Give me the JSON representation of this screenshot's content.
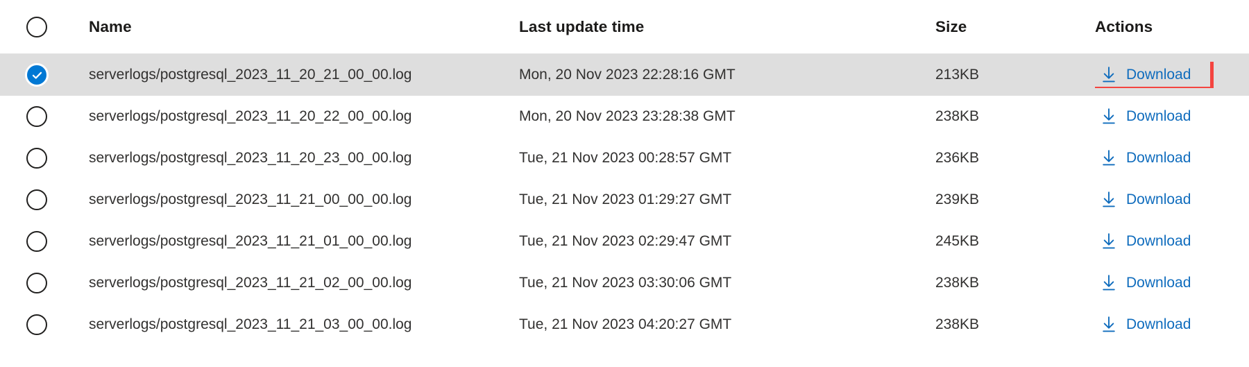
{
  "table": {
    "columns": {
      "select": "",
      "name": "Name",
      "last_update_time": "Last update time",
      "size": "Size",
      "actions": "Actions"
    },
    "header_select_icon": "unchecked-circle-icon",
    "rows": [
      {
        "selected": true,
        "select_icon": "checked-circle-icon",
        "name": "serverlogs/postgresql_2023_11_20_21_00_00.log",
        "last_update_time": "Mon, 20 Nov 2023 22:28:16 GMT",
        "size": "213KB",
        "action_label": "Download",
        "action_icon": "download-arrow-icon",
        "highlighted": true
      },
      {
        "selected": false,
        "select_icon": "unchecked-circle-icon",
        "name": "serverlogs/postgresql_2023_11_20_22_00_00.log",
        "last_update_time": "Mon, 20 Nov 2023 23:28:38 GMT",
        "size": "238KB",
        "action_label": "Download",
        "action_icon": "download-arrow-icon",
        "highlighted": false
      },
      {
        "selected": false,
        "select_icon": "unchecked-circle-icon",
        "name": "serverlogs/postgresql_2023_11_20_23_00_00.log",
        "last_update_time": "Tue, 21 Nov 2023 00:28:57 GMT",
        "size": "236KB",
        "action_label": "Download",
        "action_icon": "download-arrow-icon",
        "highlighted": false
      },
      {
        "selected": false,
        "select_icon": "unchecked-circle-icon",
        "name": "serverlogs/postgresql_2023_11_21_00_00_00.log",
        "last_update_time": "Tue, 21 Nov 2023 01:29:27 GMT",
        "size": "239KB",
        "action_label": "Download",
        "action_icon": "download-arrow-icon",
        "highlighted": false
      },
      {
        "selected": false,
        "select_icon": "unchecked-circle-icon",
        "name": "serverlogs/postgresql_2023_11_21_01_00_00.log",
        "last_update_time": "Tue, 21 Nov 2023 02:29:47 GMT",
        "size": "245KB",
        "action_label": "Download",
        "action_icon": "download-arrow-icon",
        "highlighted": false
      },
      {
        "selected": false,
        "select_icon": "unchecked-circle-icon",
        "name": "serverlogs/postgresql_2023_11_21_02_00_00.log",
        "last_update_time": "Tue, 21 Nov 2023 03:30:06 GMT",
        "size": "238KB",
        "action_label": "Download",
        "action_icon": "download-arrow-icon",
        "highlighted": false
      },
      {
        "selected": false,
        "select_icon": "unchecked-circle-icon",
        "name": "serverlogs/postgresql_2023_11_21_03_00_00.log",
        "last_update_time": "Tue, 21 Nov 2023 04:20:27 GMT",
        "size": "238KB",
        "action_label": "Download",
        "action_icon": "download-arrow-icon",
        "highlighted": false
      }
    ]
  },
  "colors": {
    "link": "#0f6cbd",
    "selected_row_bg": "#dedede",
    "checked_circle": "#0078d4",
    "highlight_border": "#f4443f",
    "text": "#323130",
    "header_text": "#1b1a19"
  }
}
